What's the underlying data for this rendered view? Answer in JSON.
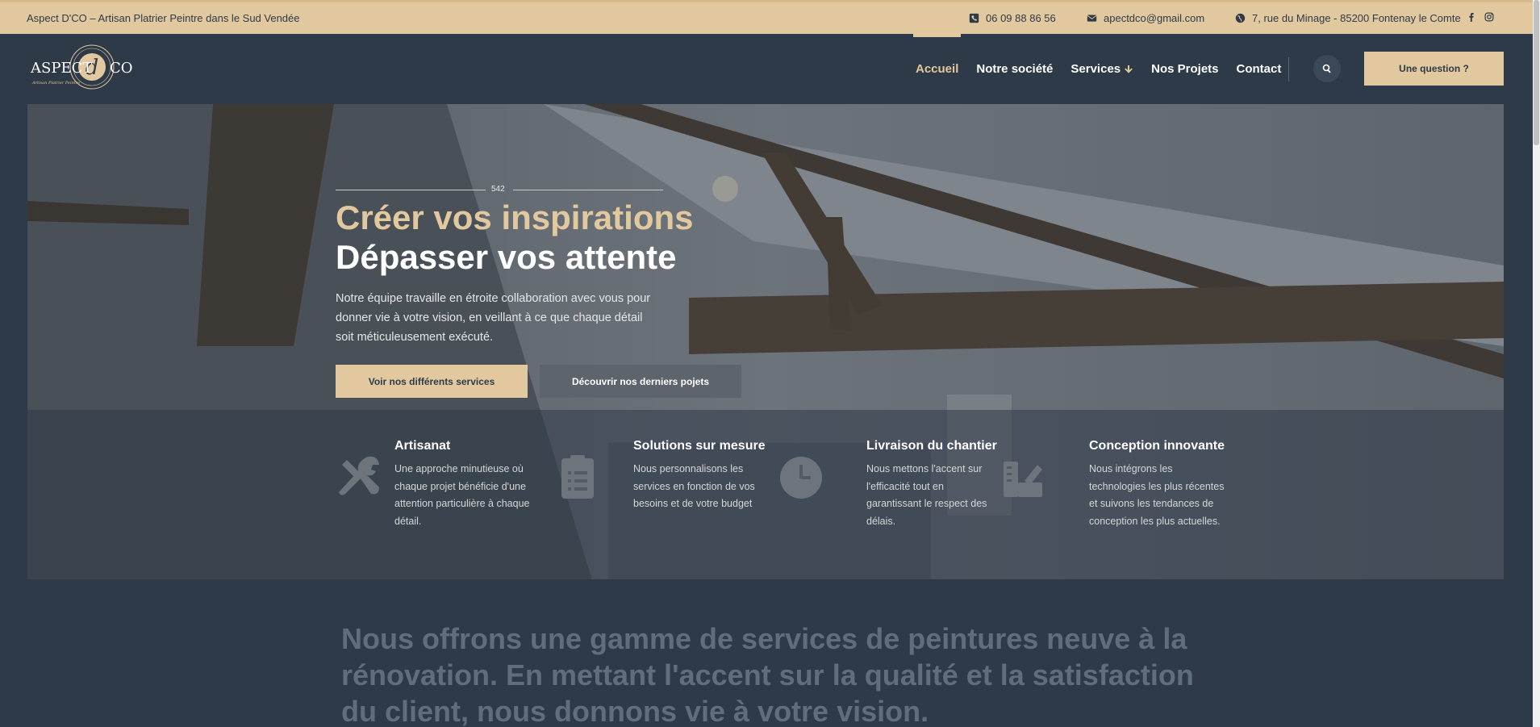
{
  "topbar": {
    "tagline": "Aspect D'CO – Artisan Platrier Peintre dans le Sud Vendée",
    "phone": "06 09 88 86 56",
    "email": "apectdco@gmail.com",
    "address": "7, rue du Minage - 85200 Fontenay le Comte"
  },
  "logo": {
    "text_left": "ASPECT",
    "text_right": "CO",
    "tagline": "Artisan Platrier Peintre"
  },
  "nav": {
    "items": [
      "Accueil",
      "Notre société",
      "Services",
      "Nos Projets",
      "Contact"
    ],
    "cta": "Une question ?"
  },
  "hero": {
    "counter": "542",
    "title_gold": "Créer vos inspirations",
    "title_white": "Dépasser vos attente",
    "description": "Notre équipe travaille en étroite collaboration avec vous pour donner vie à votre vision, en veillant à ce que chaque détail soit méticuleusement exécuté.",
    "btn_services": "Voir nos différents services",
    "btn_projects": "Découvrir nos derniers pojets"
  },
  "features": [
    {
      "title": "Artisanat",
      "desc": "Une approche minutieuse où chaque projet bénéficie d'une attention particulière à chaque détail.",
      "icon": "tools-icon"
    },
    {
      "title": "Solutions sur mesure",
      "desc": "Nous personnalisons les services en fonction de vos besoins et de votre budget",
      "icon": "clipboard-icon"
    },
    {
      "title": "Livraison du chantier",
      "desc": "Nous mettons l'accent sur l'efficacité tout en garantissant le respect des délais.",
      "icon": "clock-icon"
    },
    {
      "title": "Conception innovante",
      "desc": "Nous intégrons les technologies les plus récentes et suivons les tendances de conception les plus actuelles.",
      "icon": "design-icon"
    }
  ],
  "intro": "Nous offrons une gamme de services de peintures neuve à la rénovation. En mettant l'accent sur la qualité et la satisfaction du client, nous donnons vie à votre vision.",
  "colors": {
    "gold": "#e2c89f",
    "navy": "#2e3a48"
  }
}
